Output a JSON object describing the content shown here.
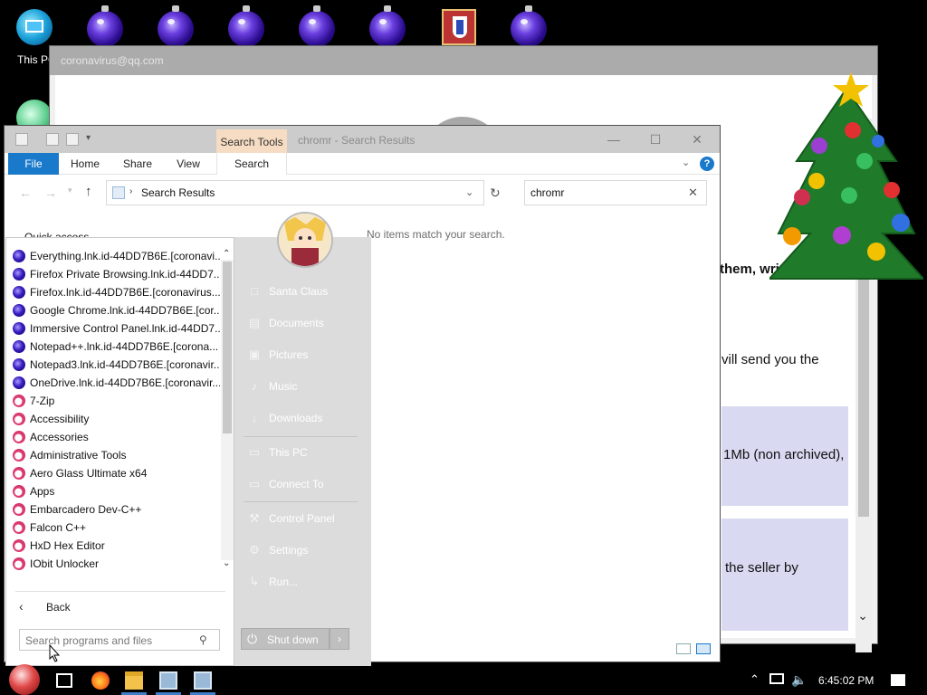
{
  "desktop": {
    "this_pc_label": "This PC",
    "icons": [
      "this-pc-icon",
      "ornament-icon",
      "ornament-icon",
      "ornament-icon",
      "ornament-icon",
      "ornament-icon",
      "app-icon",
      "ornament-icon"
    ]
  },
  "background_window": {
    "title": "coronavirus@qq.com",
    "lines": [
      "them, write us to",
      "vill send you the",
      "1Mb (non archived),",
      "the seller by"
    ]
  },
  "explorer": {
    "title": "chromr - Search Results",
    "context_tab": "Search Tools",
    "ribbon_tabs": [
      "File",
      "Home",
      "Share",
      "View",
      "Search"
    ],
    "address": "Search Results",
    "search_value": "chromr",
    "empty_message": "No items match your search.",
    "quick_access": "Quick access",
    "help": "?"
  },
  "start_menu": {
    "programs": [
      {
        "label": "Everything.lnk.id-44DD7B6E.[coronavi...",
        "icon": "blue"
      },
      {
        "label": "Firefox Private Browsing.lnk.id-44DD7...",
        "icon": "blue"
      },
      {
        "label": "Firefox.lnk.id-44DD7B6E.[coronavirus...",
        "icon": "blue"
      },
      {
        "label": "Google Chrome.lnk.id-44DD7B6E.[cor...",
        "icon": "blue"
      },
      {
        "label": "Immersive Control Panel.lnk.id-44DD7...",
        "icon": "blue"
      },
      {
        "label": "Notepad++.lnk.id-44DD7B6E.[corona...",
        "icon": "blue"
      },
      {
        "label": "Notepad3.lnk.id-44DD7B6E.[coronavir...",
        "icon": "blue"
      },
      {
        "label": "OneDrive.lnk.id-44DD7B6E.[coronavir...",
        "icon": "blue"
      },
      {
        "label": "7-Zip",
        "icon": "red"
      },
      {
        "label": "Accessibility",
        "icon": "red"
      },
      {
        "label": "Accessories",
        "icon": "red"
      },
      {
        "label": "Administrative Tools",
        "icon": "red"
      },
      {
        "label": "Aero Glass Ultimate x64",
        "icon": "red"
      },
      {
        "label": "Apps",
        "icon": "red"
      },
      {
        "label": "Embarcadero Dev-C++",
        "icon": "red"
      },
      {
        "label": "Falcon C++",
        "icon": "red"
      },
      {
        "label": "HxD Hex Editor",
        "icon": "red"
      },
      {
        "label": "IObit Unlocker",
        "icon": "red"
      }
    ],
    "back_label": "Back",
    "search_placeholder": "Search programs and files",
    "right_items": [
      {
        "label": "Santa Claus",
        "icon": "user-icon"
      },
      {
        "label": "Documents",
        "icon": "documents-icon"
      },
      {
        "label": "Pictures",
        "icon": "pictures-icon"
      },
      {
        "label": "Music",
        "icon": "music-icon"
      },
      {
        "label": "Downloads",
        "icon": "downloads-icon"
      },
      {
        "label": "This PC",
        "icon": "computer-icon"
      },
      {
        "label": "Connect To",
        "icon": "connect-icon"
      },
      {
        "label": "Control Panel",
        "icon": "control-panel-icon"
      },
      {
        "label": "Settings",
        "icon": "gear-icon"
      },
      {
        "label": "Run...",
        "icon": "run-icon"
      }
    ],
    "shutdown_label": "Shut down"
  },
  "taskbar": {
    "clock": "6:45:02 PM",
    "icons": [
      "start-orb-icon",
      "task-view-icon",
      "firefox-icon",
      "file-explorer-icon",
      "app-icon",
      "app-icon"
    ]
  },
  "colors": {
    "accent": "#1979ca",
    "context_tab": "#f6dcc2",
    "bg_box": "#d9d9f2"
  }
}
